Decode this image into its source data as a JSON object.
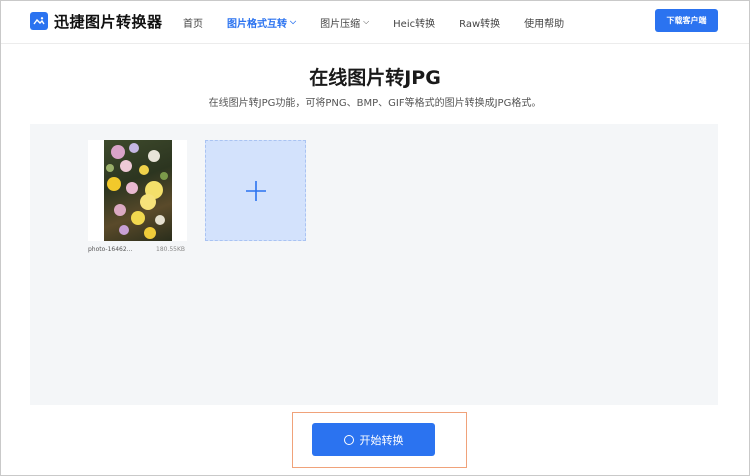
{
  "header": {
    "logo_text": "迅捷图片转换器",
    "nav": [
      {
        "label": "首页",
        "active": false,
        "dropdown": false
      },
      {
        "label": "图片格式互转",
        "active": true,
        "dropdown": true
      },
      {
        "label": "图片压缩",
        "active": false,
        "dropdown": true
      },
      {
        "label": "Heic转换",
        "active": false,
        "dropdown": false
      },
      {
        "label": "Raw转换",
        "active": false,
        "dropdown": false
      },
      {
        "label": "使用帮助",
        "active": false,
        "dropdown": false
      }
    ],
    "download_label": "下载客户端"
  },
  "page": {
    "title": "在线图片转JPG",
    "subtitle": "在线图片转JPG功能，可将PNG、BMP、GIF等格式的图片转换成JPG格式。"
  },
  "files": [
    {
      "name": "photo-16462...",
      "size": "180.55KB"
    }
  ],
  "actions": {
    "start_label": "开始转换"
  },
  "colors": {
    "accent": "#2b73f0",
    "add_box_bg": "#d3e2fc",
    "highlight_border": "#f0a27a",
    "workarea_bg": "#f4f6f8"
  }
}
